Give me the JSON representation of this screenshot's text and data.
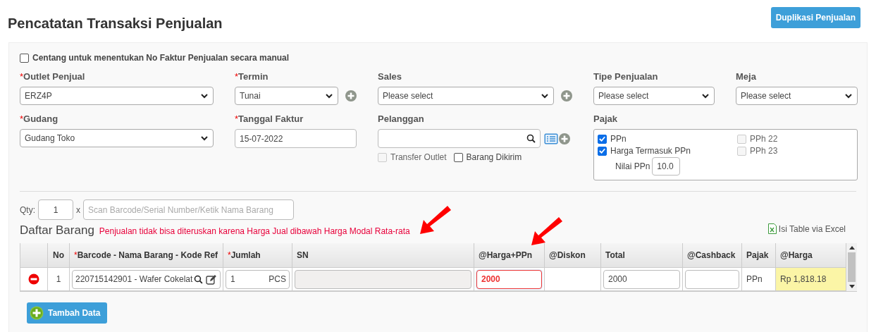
{
  "page_title": "Pencatatan Transaksi Penjualan",
  "duplicate_button": "Duplikasi Penjualan",
  "manual_invoice": {
    "label": "Centang untuk menentukan No Faktur Penjualan secara manual",
    "checked": false
  },
  "fields": [
    {
      "kind": "select",
      "mark": "*",
      "label": "Outlet Penjual",
      "value": "ERZ4P",
      "add": false
    },
    {
      "kind": "select",
      "mark": "*",
      "label": "Termin",
      "value": "Tunai",
      "add": true
    },
    {
      "kind": "select",
      "label": "Sales",
      "value": "Please select",
      "add": true
    },
    {
      "kind": "select",
      "label": "Tipe Penjualan",
      "value": "Please select",
      "add": false
    },
    {
      "kind": "select",
      "label": "Meja",
      "value": "Please select",
      "add": false
    },
    {
      "kind": "select",
      "mark": "*",
      "label": "Gudang",
      "value": "Gudang Toko",
      "add": false
    },
    {
      "kind": "text",
      "mark": "*",
      "label": "Tanggal Faktur",
      "value": "15-07-2022"
    },
    {
      "kind": "search",
      "label": "Pelanggan",
      "options": [
        {
          "label": "Transfer Outlet",
          "checked": false,
          "disabled": true
        },
        {
          "label": "Barang Dikirim",
          "checked": false,
          "disabled": false
        }
      ]
    },
    {
      "kind": "tax",
      "label": "Pajak",
      "options": [
        {
          "label": "PPn",
          "checked": true,
          "disabled": false
        },
        {
          "label": "PPh 22",
          "checked": false,
          "disabled": true
        },
        {
          "label": "Harga Termasuk PPn",
          "checked": true,
          "disabled": false
        },
        {
          "label": "PPh 23",
          "checked": false,
          "disabled": true
        }
      ],
      "rate_label": "Nilai PPn",
      "rate_value": "10.0"
    }
  ],
  "scan": {
    "qty_label": "Qty:",
    "qty": "1",
    "times": "x",
    "placeholder": "Scan Barcode/Serial Number/Ketik Nama Barang"
  },
  "items_heading": "Daftar Barang",
  "warning": "Penjualan tidak bisa diteruskan karena Harga Jual dibawah Harga Modal Rata-rata",
  "excel_link": "Isi Table via Excel",
  "table": {
    "columns": [
      {},
      {
        "label": "No"
      },
      {
        "mark": "*",
        "label": "Barcode - Nama Barang - Kode Ref"
      },
      {
        "mark": "*",
        "label": "Jumlah"
      },
      {
        "label": "SN"
      },
      {
        "label": "@Harga+PPn"
      },
      {
        "label": "@Diskon"
      },
      {
        "label": "Total"
      },
      {
        "label": "@Cashback"
      },
      {
        "label": "Pajak"
      },
      {
        "label": "@Harga"
      }
    ],
    "rows": [
      [
        {
          "kind": "remove"
        },
        {
          "kind": "number",
          "value": "1"
        },
        {
          "kind": "lookup",
          "value": "220715142901 - Wafer Cokelat"
        },
        {
          "kind": "qty",
          "value": "1",
          "unit": "PCS"
        },
        {
          "kind": "input",
          "disabled": true,
          "error": false
        },
        {
          "kind": "input",
          "value": "2000",
          "disabled": false,
          "error": true
        },
        {
          "kind": "empty"
        },
        {
          "kind": "input",
          "value": "2000",
          "disabled": false,
          "error": false
        },
        {
          "kind": "input",
          "disabled": false,
          "error": false
        },
        {
          "kind": "text",
          "value": "PPn"
        },
        {
          "kind": "highlight",
          "value": "Rp 1,818.18"
        }
      ]
    ]
  },
  "add_button": "Tambah Data"
}
